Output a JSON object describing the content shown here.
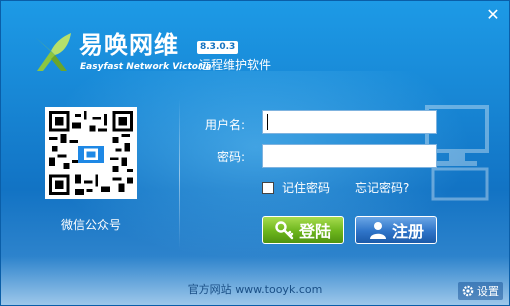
{
  "window": {
    "close_glyph": "✕"
  },
  "brand": {
    "name_cn": "易唤网维",
    "version": "8.3.0.3",
    "name_en": "Easyfast Network Victoria",
    "subtitle": "远程维护软件",
    "logo_icon": "green-leaf-logo-icon",
    "accent_color": "#8cc63f"
  },
  "qr": {
    "label": "微信公众号",
    "icon": "qr-code-icon"
  },
  "login": {
    "username_label": "用户名:",
    "username_value": "",
    "password_label": "密码:",
    "password_value": "",
    "remember_label": "记住密码",
    "remember_checked": false,
    "forgot_label": "忘记密码?",
    "login_button": "登陆",
    "register_button": "注册"
  },
  "footer": {
    "site_label": "官方网站",
    "site_url": "www.tooyk.com",
    "settings_label": "设置"
  },
  "colors": {
    "window_blue": "#1888d6",
    "login_green": "#6db51c",
    "register_blue": "#2f74c8"
  }
}
